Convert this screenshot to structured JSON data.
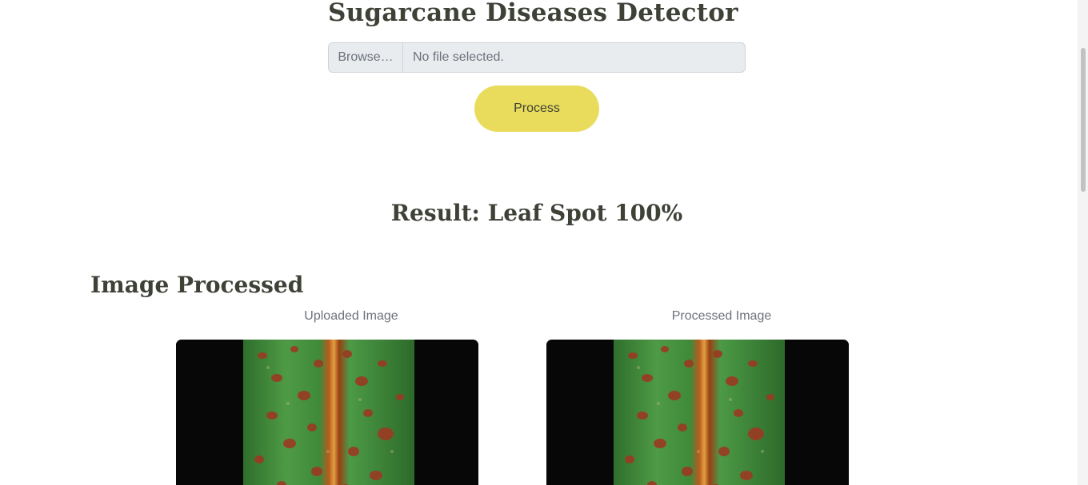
{
  "header": {
    "title": "Sugarcane Diseases Detector"
  },
  "upload": {
    "browse_label": "Browse…",
    "file_status": "No file selected.",
    "process_label": "Process"
  },
  "result": {
    "text": "Result: Leaf Spot 100%"
  },
  "images_section": {
    "title": "Image Processed",
    "uploaded_caption": "Uploaded Image",
    "processed_caption": "Processed Image"
  },
  "colors": {
    "accent_button": "#e9dc5c",
    "heading_text": "#3d4136",
    "input_background": "#e9ecef"
  },
  "icons": {
    "leaf_image": "sugarcane-leaf-spot-photo"
  }
}
